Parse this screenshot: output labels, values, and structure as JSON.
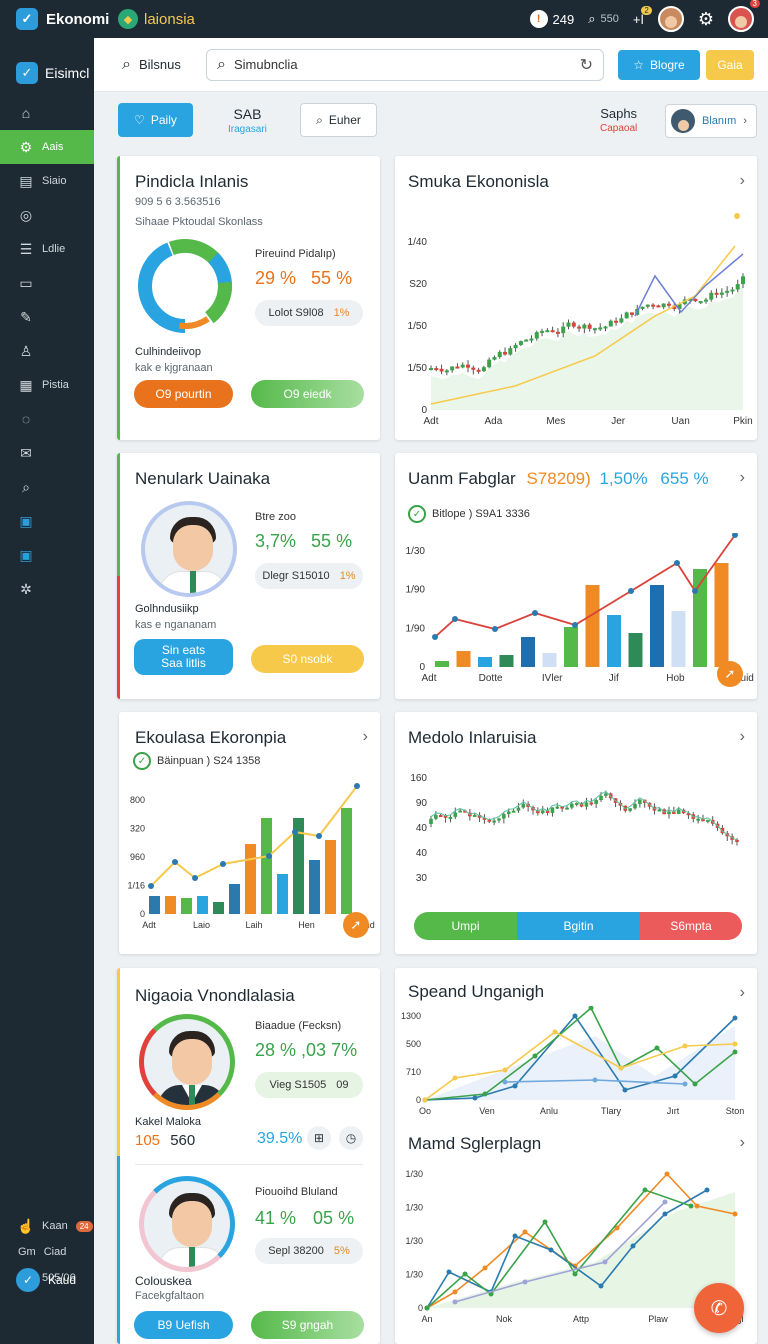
{
  "topbar": {
    "app_name": "Ekonomi",
    "brand2": "laionsia",
    "coins_value": "249",
    "search_label": "550",
    "notif_badge": "2",
    "profile_badge": "3"
  },
  "sidebar": {
    "title": "Eisimcl",
    "items": [
      {
        "icon": "home-icon",
        "label": ""
      },
      {
        "icon": "gear-icon",
        "label": "Aais"
      },
      {
        "icon": "document-icon",
        "label": "Siaio"
      },
      {
        "icon": "target-icon",
        "label": ""
      },
      {
        "icon": "list-icon",
        "label": "Ldlie"
      },
      {
        "icon": "folder-icon",
        "label": ""
      },
      {
        "icon": "pen-icon",
        "label": ""
      },
      {
        "icon": "person-icon",
        "label": ""
      },
      {
        "icon": "chart-icon",
        "label": "Pistia"
      },
      {
        "icon": "chat-icon",
        "label": ""
      },
      {
        "icon": "mail-icon",
        "label": ""
      },
      {
        "icon": "search-icon",
        "label": ""
      },
      {
        "icon": "report-icon",
        "label": ""
      },
      {
        "icon": "window-icon",
        "label": ""
      },
      {
        "icon": "settings-icon",
        "label": ""
      }
    ],
    "bottom": [
      {
        "label": "Kaan",
        "badge": "24"
      },
      {
        "label": "Ciad",
        "prefix": "Gm"
      },
      {
        "label": "505/06"
      }
    ],
    "user": "Kaud"
  },
  "header": {
    "title": "Bilsnus",
    "search_value": "Simubnclia",
    "primary_button": "Blogre",
    "secondary_button": "Gaia"
  },
  "filters": {
    "chip_blue": "Paily",
    "tab_title": "SAB",
    "tab_sub": "Iragasari",
    "chip_white": "Euher",
    "right_title": "Saphs",
    "right_sub": "Capaoal",
    "user_chip": "Blanım"
  },
  "cards": {
    "c1": {
      "title": "Pindicla Inlanis",
      "line1": "909  5 6 3.563516",
      "line2": "Sihaae Pktoudal Skonlass",
      "stat_label": "Pireuind Pidalıp)",
      "pct1": "29 %",
      "pct2": "55 %",
      "pill_light": "Lolot  S9l08",
      "pill_light_tiny": "1%",
      "name": "Culhindeiivop",
      "role": "kak e kjgranaan",
      "btn1": "O9 pourtin",
      "btn2": "O9 eiedk"
    },
    "c2": {
      "title": "Smuka Ekononisla",
      "ylabels": [
        "1/40",
        "S20",
        "1/50",
        "1/50",
        "0"
      ],
      "xlabels": [
        "Adt",
        "Ada",
        "Mes",
        "Jer",
        "Uan",
        "Pkin"
      ]
    },
    "c3": {
      "title": "Nenulark Uainaka",
      "stat_label": "Btre zoo",
      "pct1": "3,7%",
      "pct2": "55 %",
      "pill_light": "Dlegr  S15010",
      "pill_light_tiny": "1%",
      "name": "Golhndusiikp",
      "role": "kas e ngananam",
      "btn1": "Sin eats Saa litlis",
      "btn2": "S0 nsobk"
    },
    "c4": {
      "title": "Uanm Fabglar",
      "title_v1": "S78209)",
      "title_v2": "1,50%",
      "title_v3": "655 %",
      "meta": "Bitlope )  S9A1 3336",
      "ylabels": [
        "1/30",
        "1/90",
        "1/90",
        "0"
      ],
      "xlabels": [
        "Adt",
        "Dotte",
        "IVler",
        "Jif",
        "Hob",
        "Weduid"
      ]
    },
    "c5": {
      "title": "Ekoulasa Ekoronpia",
      "meta": "Bäinpuan )  S24 1358",
      "ylabels": [
        "800",
        "320",
        "960",
        "1/16",
        "0"
      ],
      "xlabels": [
        "Adt",
        "Laio",
        "Laih",
        "Hen",
        "Detamd"
      ]
    },
    "c6": {
      "title": "Medolo Inlaruisia",
      "ylabels": [
        "160",
        "90",
        "40",
        "40",
        "30"
      ],
      "legend": [
        "Umpi",
        "Bgitin",
        "S6mpta"
      ]
    },
    "c7": {
      "title": "Nigaoia Vnondlalasia",
      "stat_label": "Biaadue (Fecksn)",
      "pct": "28 %  ,03 7%",
      "pill_light": "Vieg  S1505",
      "pill_light_tiny": "09",
      "name": "Kakel Maloka",
      "num1": "105",
      "num2": "560",
      "pct_blue": "39.5%",
      "stat_label2": "Piouoihd Bluland",
      "pct2a": "41 %",
      "pct2b": "05 %",
      "pill_light2": "Sepl  38200",
      "pill_light2_tiny": "5%",
      "name2": "Colouskea",
      "role2": "Facekgfaltaon",
      "btn1": "B9 Uefish",
      "btn2": "S9 gngah"
    },
    "c8": {
      "title": "Speand Unganigh",
      "ylabels": [
        "1300",
        "500",
        "710",
        "0"
      ],
      "xlabels": [
        "Oo",
        "Ven",
        "Anlu",
        "Tlary",
        "Jırt",
        "Ston"
      ]
    },
    "c9": {
      "title": "Mamd Sglerplagn",
      "ylabels": [
        "1/30",
        "1/30",
        "1/30",
        "1/30",
        "0"
      ],
      "xlabels": [
        "An",
        "Nok",
        "Attp",
        "Plaw",
        "Legl"
      ]
    }
  },
  "colors": {
    "green": "#55b94a",
    "blue": "#2aa4e0",
    "orange": "#e8731c",
    "red": "#e0413a",
    "yellow": "#f7c94a",
    "dark": "#1e2a33"
  }
}
